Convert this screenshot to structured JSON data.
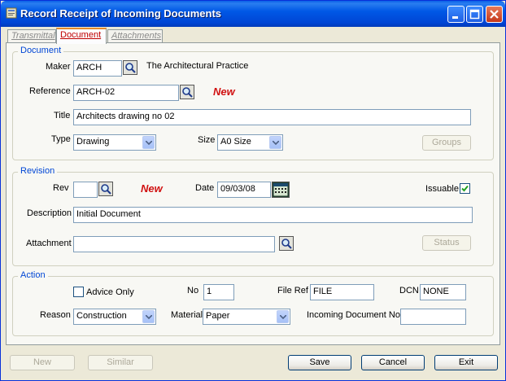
{
  "window": {
    "title": "Record Receipt of Incoming Documents"
  },
  "tabs": [
    {
      "label": "Transmittal"
    },
    {
      "label": "Document"
    },
    {
      "label": "Attachments"
    }
  ],
  "document": {
    "group_title": "Document",
    "maker_label": "Maker",
    "maker_value": "ARCH",
    "maker_name": "The Architectural Practice",
    "reference_label": "Reference",
    "reference_value": "ARCH-02",
    "reference_badge": "New",
    "title_label": "Title",
    "title_value": "Architects drawing no 02",
    "type_label": "Type",
    "type_value": "Drawing",
    "size_label": "Size",
    "size_value": "A0 Size",
    "groups_button": "Groups"
  },
  "revision": {
    "group_title": "Revision",
    "rev_label": "Rev",
    "rev_value": "",
    "rev_badge": "New",
    "date_label": "Date",
    "date_value": "09/03/08",
    "issuable_label": "Issuable",
    "issuable_checked": true,
    "description_label": "Description",
    "description_value": "Initial Document",
    "attachment_label": "Attachment",
    "attachment_value": "",
    "status_button": "Status"
  },
  "action": {
    "group_title": "Action",
    "advice_only_label": "Advice Only",
    "advice_only_checked": false,
    "no_label": "No",
    "no_value": "1",
    "file_ref_label": "File Ref",
    "file_ref_value": "FILE",
    "dcn_label": "DCN",
    "dcn_value": "NONE",
    "reason_label": "Reason",
    "reason_value": "Construction",
    "material_label": "Material",
    "material_value": "Paper",
    "incoming_doc_no_label": "Incoming Document No",
    "incoming_doc_no_value": ""
  },
  "footer": {
    "new_button": "New",
    "similar_button": "Similar",
    "save_button": "Save",
    "cancel_button": "Cancel",
    "exit_button": "Exit"
  }
}
